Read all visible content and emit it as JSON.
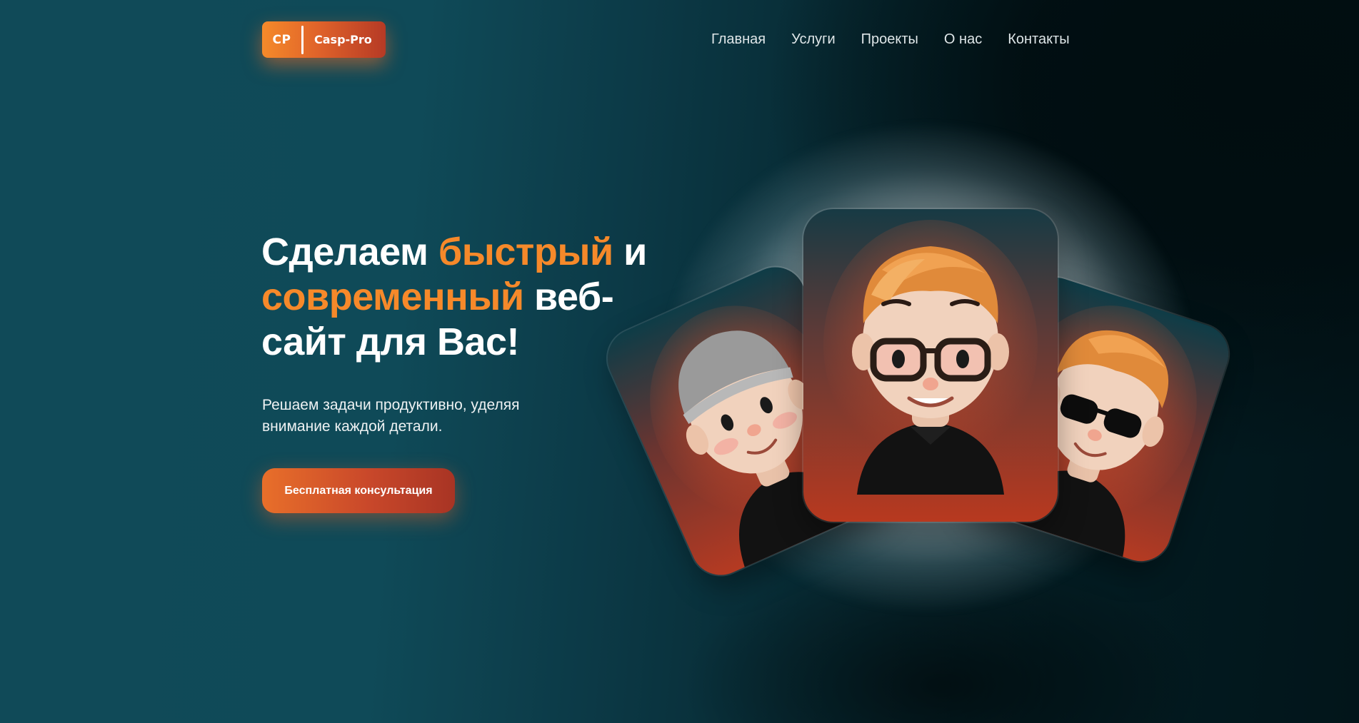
{
  "brand": {
    "mark": "CP",
    "name": "Casp-Pro",
    "accent_color": "#f6892a"
  },
  "nav": {
    "items": [
      {
        "label": "Главная"
      },
      {
        "label": "Услуги"
      },
      {
        "label": "Проекты"
      },
      {
        "label": "О нас"
      },
      {
        "label": "Контакты"
      }
    ]
  },
  "hero": {
    "title_part1": "Сделаем ",
    "title_accent1": "быстрый",
    "title_part2": " и",
    "title_accent2": "современный",
    "title_part3": " веб-",
    "title_part4": "сайт для Вас!",
    "subtitle": "Решаем задачи продуктивно, уделяя внимание каждой детали.",
    "cta_label": "Бесплатная консультация"
  },
  "illustration": {
    "avatars": [
      {
        "icon": "avatar-beanie-icon"
      },
      {
        "icon": "avatar-glasses-icon"
      },
      {
        "icon": "avatar-sunglasses-icon"
      }
    ]
  }
}
